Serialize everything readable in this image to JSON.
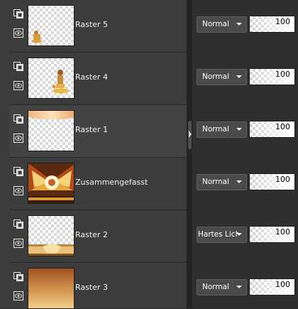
{
  "layers": [
    {
      "name": "Raster 5",
      "blend_mode": "Normal",
      "opacity": 100,
      "thumb": "tiny-figure",
      "selected": false
    },
    {
      "name": "Raster 4",
      "blend_mode": "Normal",
      "opacity": 100,
      "thumb": "figure",
      "selected": false
    },
    {
      "name": "Raster 1",
      "blend_mode": "Normal",
      "opacity": 100,
      "thumb": "top-band",
      "selected": true
    },
    {
      "name": "Zusammengefasst",
      "blend_mode": "Normal",
      "opacity": 100,
      "thumb": "merged",
      "selected": false
    },
    {
      "name": "Raster 2",
      "blend_mode": "Hartes Licht",
      "opacity": 100,
      "thumb": "bottom-band",
      "selected": false
    },
    {
      "name": "Raster 3",
      "blend_mode": "Normal",
      "opacity": 100,
      "thumb": "gradient",
      "selected": false
    }
  ],
  "icons": {
    "mask": "mask-link-icon",
    "visibility": "eye-icon",
    "dropdown": "chevron-down-icon",
    "splitter": "chevron-right-icon"
  },
  "colors": {
    "panel": "#3c3c3c",
    "panel_selected": "#434343",
    "props_bg": "#2f2f2f",
    "splitter": "#232323",
    "select_bg": "#4a4a4a"
  }
}
